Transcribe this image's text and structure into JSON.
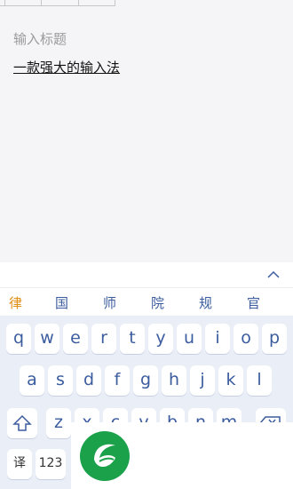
{
  "editor": {
    "title_placeholder": "输入标题",
    "body_text": "一款强大的输入法"
  },
  "keyboard": {
    "candidates": [
      "律",
      "国",
      "师",
      "院",
      "规",
      "官"
    ],
    "accent_color": "#e1901a",
    "key_text_color": "#3b5c9e",
    "rows": {
      "row1": [
        "q",
        "w",
        "e",
        "r",
        "t",
        "y",
        "u",
        "i",
        "o",
        "p"
      ],
      "row2": [
        "a",
        "s",
        "d",
        "f",
        "g",
        "h",
        "j",
        "k",
        "l"
      ],
      "row3": [
        "z",
        "x",
        "c",
        "v",
        "b",
        "n",
        "m"
      ]
    },
    "bottom": {
      "translate_label": "译",
      "numbers_label": "123"
    },
    "icons": {
      "collapse": "chevron-up-icon",
      "shift": "shift-icon",
      "delete": "backspace-icon"
    }
  },
  "overlay": {
    "logo": "leaf-logo-icon",
    "logo_color": "#1aa14a"
  }
}
